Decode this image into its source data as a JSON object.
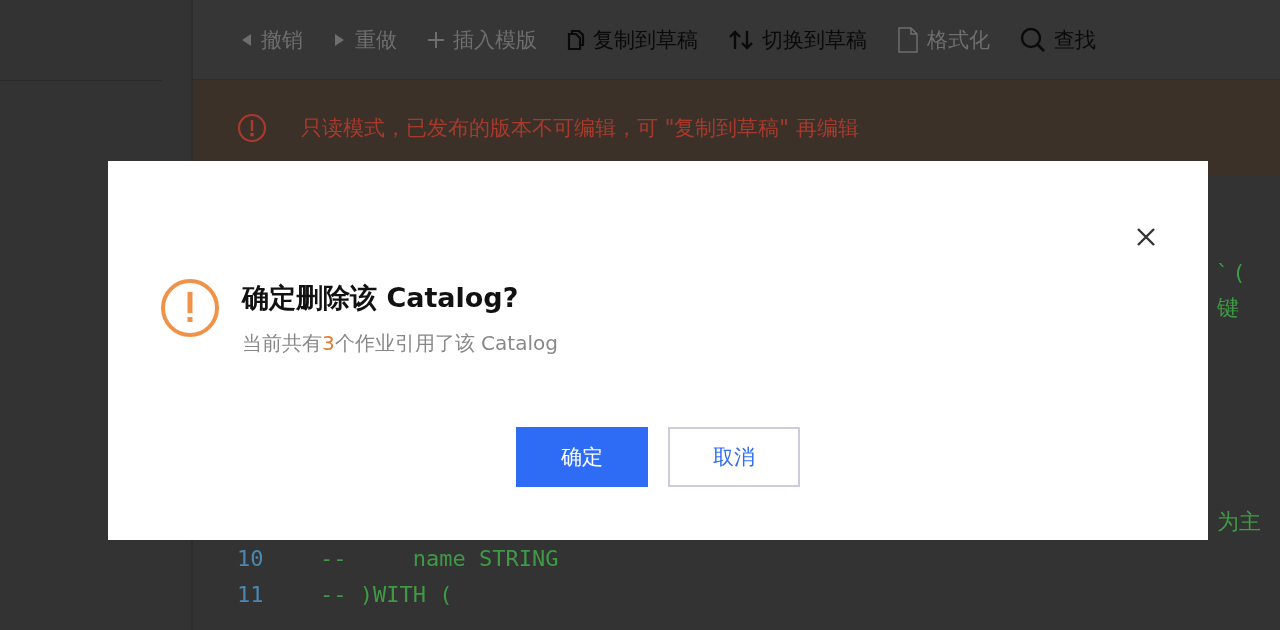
{
  "toolbar": [
    {
      "label": "撤销",
      "kind": "undo",
      "disabled": true
    },
    {
      "label": "重做",
      "kind": "redo",
      "disabled": true
    },
    {
      "label": "插入模版",
      "kind": "insert",
      "disabled": true
    },
    {
      "label": "复制到草稿",
      "kind": "copy",
      "disabled": false
    },
    {
      "label": "切换到草稿",
      "kind": "switch",
      "disabled": false
    },
    {
      "label": "格式化",
      "kind": "format",
      "disabled": true
    },
    {
      "label": "查找",
      "kind": "search",
      "disabled": false
    }
  ],
  "banner": {
    "text": "只读模式，已发布的版本不可编辑，可 \"复制到草稿\" 再编辑"
  },
  "editor": {
    "top_lines": [
      {
        "fragment": "` ("
      },
      {
        "fragment": "键"
      }
    ],
    "bottom_lines": [
      {
        "fragment": "为主"
      },
      {
        "number": "10",
        "code": "--     name STRING"
      },
      {
        "number": "11",
        "code": "-- )WITH ("
      }
    ]
  },
  "dialog": {
    "title": "确定删除该 Catalog?",
    "message_before": "当前共有",
    "count": "3",
    "message_after": "个作业引用了该 Catalog",
    "buttons": [
      {
        "label": "确定",
        "kind": "primary"
      },
      {
        "label": "取消",
        "kind": "secondary"
      }
    ]
  }
}
